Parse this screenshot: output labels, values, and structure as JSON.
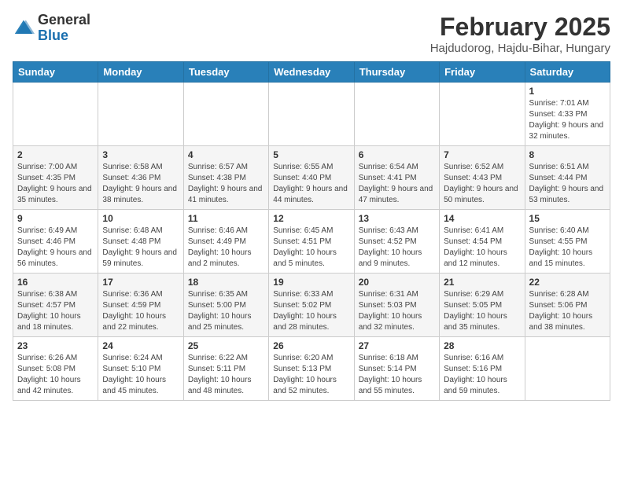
{
  "logo": {
    "general": "General",
    "blue": "Blue"
  },
  "header": {
    "month": "February 2025",
    "location": "Hajdudorog, Hajdu-Bihar, Hungary"
  },
  "weekdays": [
    "Sunday",
    "Monday",
    "Tuesday",
    "Wednesday",
    "Thursday",
    "Friday",
    "Saturday"
  ],
  "weeks": [
    [
      {
        "day": "",
        "info": ""
      },
      {
        "day": "",
        "info": ""
      },
      {
        "day": "",
        "info": ""
      },
      {
        "day": "",
        "info": ""
      },
      {
        "day": "",
        "info": ""
      },
      {
        "day": "",
        "info": ""
      },
      {
        "day": "1",
        "info": "Sunrise: 7:01 AM\nSunset: 4:33 PM\nDaylight: 9 hours and 32 minutes."
      }
    ],
    [
      {
        "day": "2",
        "info": "Sunrise: 7:00 AM\nSunset: 4:35 PM\nDaylight: 9 hours and 35 minutes."
      },
      {
        "day": "3",
        "info": "Sunrise: 6:58 AM\nSunset: 4:36 PM\nDaylight: 9 hours and 38 minutes."
      },
      {
        "day": "4",
        "info": "Sunrise: 6:57 AM\nSunset: 4:38 PM\nDaylight: 9 hours and 41 minutes."
      },
      {
        "day": "5",
        "info": "Sunrise: 6:55 AM\nSunset: 4:40 PM\nDaylight: 9 hours and 44 minutes."
      },
      {
        "day": "6",
        "info": "Sunrise: 6:54 AM\nSunset: 4:41 PM\nDaylight: 9 hours and 47 minutes."
      },
      {
        "day": "7",
        "info": "Sunrise: 6:52 AM\nSunset: 4:43 PM\nDaylight: 9 hours and 50 minutes."
      },
      {
        "day": "8",
        "info": "Sunrise: 6:51 AM\nSunset: 4:44 PM\nDaylight: 9 hours and 53 minutes."
      }
    ],
    [
      {
        "day": "9",
        "info": "Sunrise: 6:49 AM\nSunset: 4:46 PM\nDaylight: 9 hours and 56 minutes."
      },
      {
        "day": "10",
        "info": "Sunrise: 6:48 AM\nSunset: 4:48 PM\nDaylight: 9 hours and 59 minutes."
      },
      {
        "day": "11",
        "info": "Sunrise: 6:46 AM\nSunset: 4:49 PM\nDaylight: 10 hours and 2 minutes."
      },
      {
        "day": "12",
        "info": "Sunrise: 6:45 AM\nSunset: 4:51 PM\nDaylight: 10 hours and 5 minutes."
      },
      {
        "day": "13",
        "info": "Sunrise: 6:43 AM\nSunset: 4:52 PM\nDaylight: 10 hours and 9 minutes."
      },
      {
        "day": "14",
        "info": "Sunrise: 6:41 AM\nSunset: 4:54 PM\nDaylight: 10 hours and 12 minutes."
      },
      {
        "day": "15",
        "info": "Sunrise: 6:40 AM\nSunset: 4:55 PM\nDaylight: 10 hours and 15 minutes."
      }
    ],
    [
      {
        "day": "16",
        "info": "Sunrise: 6:38 AM\nSunset: 4:57 PM\nDaylight: 10 hours and 18 minutes."
      },
      {
        "day": "17",
        "info": "Sunrise: 6:36 AM\nSunset: 4:59 PM\nDaylight: 10 hours and 22 minutes."
      },
      {
        "day": "18",
        "info": "Sunrise: 6:35 AM\nSunset: 5:00 PM\nDaylight: 10 hours and 25 minutes."
      },
      {
        "day": "19",
        "info": "Sunrise: 6:33 AM\nSunset: 5:02 PM\nDaylight: 10 hours and 28 minutes."
      },
      {
        "day": "20",
        "info": "Sunrise: 6:31 AM\nSunset: 5:03 PM\nDaylight: 10 hours and 32 minutes."
      },
      {
        "day": "21",
        "info": "Sunrise: 6:29 AM\nSunset: 5:05 PM\nDaylight: 10 hours and 35 minutes."
      },
      {
        "day": "22",
        "info": "Sunrise: 6:28 AM\nSunset: 5:06 PM\nDaylight: 10 hours and 38 minutes."
      }
    ],
    [
      {
        "day": "23",
        "info": "Sunrise: 6:26 AM\nSunset: 5:08 PM\nDaylight: 10 hours and 42 minutes."
      },
      {
        "day": "24",
        "info": "Sunrise: 6:24 AM\nSunset: 5:10 PM\nDaylight: 10 hours and 45 minutes."
      },
      {
        "day": "25",
        "info": "Sunrise: 6:22 AM\nSunset: 5:11 PM\nDaylight: 10 hours and 48 minutes."
      },
      {
        "day": "26",
        "info": "Sunrise: 6:20 AM\nSunset: 5:13 PM\nDaylight: 10 hours and 52 minutes."
      },
      {
        "day": "27",
        "info": "Sunrise: 6:18 AM\nSunset: 5:14 PM\nDaylight: 10 hours and 55 minutes."
      },
      {
        "day": "28",
        "info": "Sunrise: 6:16 AM\nSunset: 5:16 PM\nDaylight: 10 hours and 59 minutes."
      },
      {
        "day": "",
        "info": ""
      }
    ]
  ]
}
